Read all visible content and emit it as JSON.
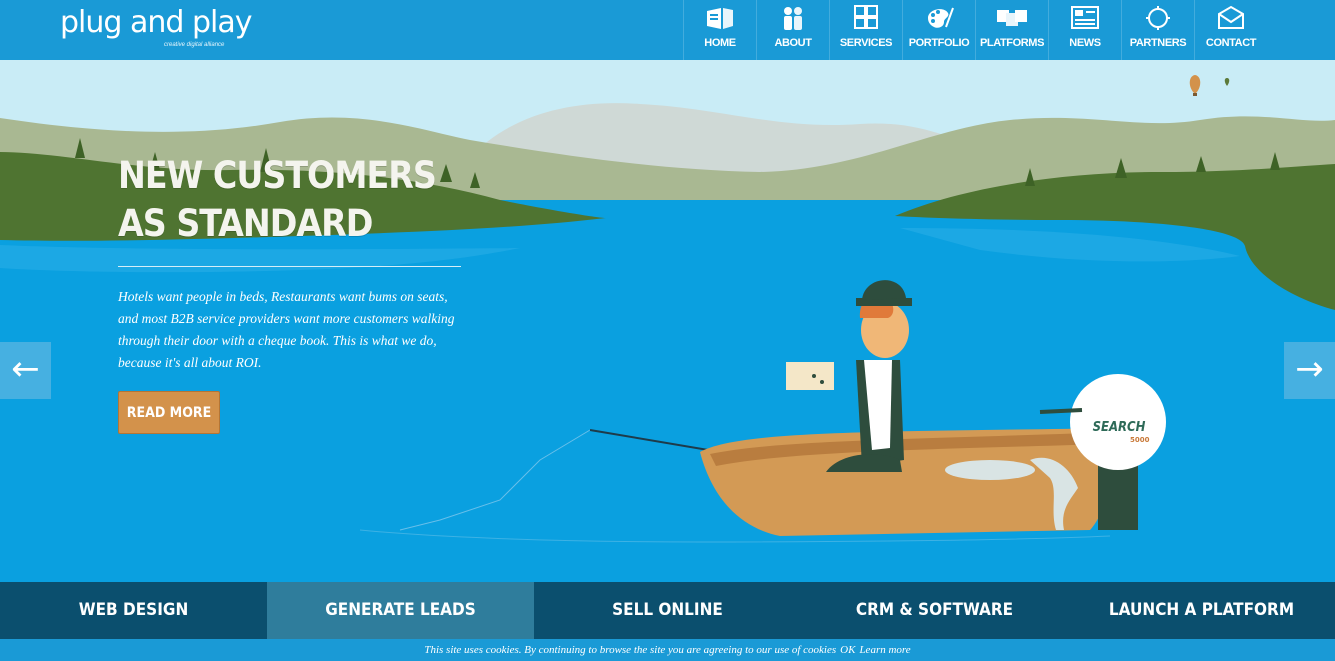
{
  "header": {
    "logo": {
      "name": "plug and play",
      "tagline": "creative digital alliance"
    },
    "nav": [
      {
        "label": "HOME",
        "icon": "home-icon"
      },
      {
        "label": "ABOUT",
        "icon": "people-icon"
      },
      {
        "label": "SERVICES",
        "icon": "grid-icon"
      },
      {
        "label": "PORTFOLIO",
        "icon": "palette-icon"
      },
      {
        "label": "PLATFORMS",
        "icon": "platforms-icon"
      },
      {
        "label": "NEWS",
        "icon": "newspaper-icon"
      },
      {
        "label": "PARTNERS",
        "icon": "partners-icon"
      },
      {
        "label": "CONTACT",
        "icon": "envelope-icon"
      }
    ]
  },
  "hero": {
    "headline_line1": "NEW CUSTOMERS",
    "headline_line2": "AS STANDARD",
    "description": "Hotels want people in beds, Restaurants want bums on seats, and most B2B service providers want more customers walking through their door with a cheque book. This is what we do, because it's all about ROI.",
    "read_more": "READ MORE",
    "engine_brand": "SEARCH",
    "engine_model": "5000"
  },
  "tabs": [
    {
      "label": "WEB DESIGN",
      "active": false
    },
    {
      "label": "GENERATE LEADS",
      "active": true
    },
    {
      "label": "SELL ONLINE",
      "active": false
    },
    {
      "label": "CRM & SOFTWARE",
      "active": false
    },
    {
      "label": "LAUNCH A PLATFORM",
      "active": false
    }
  ],
  "cookie": {
    "text": "This site uses cookies. By continuing to browse the site you are agreeing to our use of cookies",
    "ok": "OK",
    "learn_more": "Learn more"
  },
  "colors": {
    "primary": "#1a9ad6",
    "tab_bar": "#0b4f6e",
    "tab_active": "#2f7d9c",
    "button": "#d3924b"
  }
}
